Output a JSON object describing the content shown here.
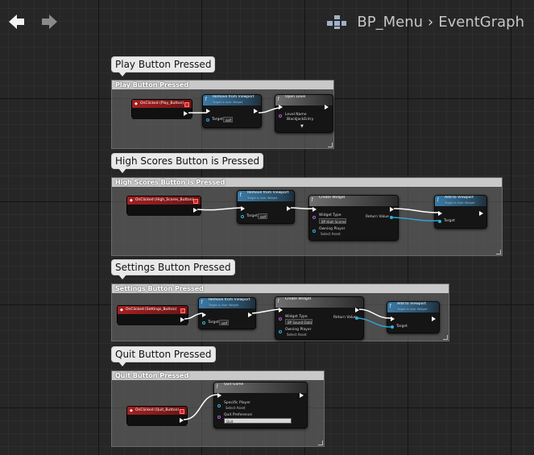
{
  "toolbar": {
    "back_icon": "arrow-left-icon",
    "forward_icon": "arrow-right-icon",
    "blueprint_icon": "blueprint-grid-icon",
    "breadcrumb_root": "BP_Menu",
    "breadcrumb_separator": "›",
    "breadcrumb_current": "EventGraph"
  },
  "groups": [
    {
      "bubble": "Play Button Pressed",
      "comment": "Play Button Pressed",
      "event": "OnClicked (Play_Button)",
      "node1": {
        "title": "Remove from Viewport",
        "sub": "Target is User Widget",
        "target": "Target",
        "self": "self"
      },
      "node2": {
        "title": "Open Level",
        "level_name": "Level Name",
        "level_value": "BlackJackEntry"
      }
    },
    {
      "bubble": "High Scores Button is Pressed",
      "comment": "High Scores Button is Pressed",
      "event": "OnClicked (High_Scores_Button)",
      "node1": {
        "title": "Remove from Viewport",
        "sub": "Target is User Widget",
        "target": "Target",
        "self": "self"
      },
      "node2": {
        "title": "Create Widget",
        "class": "Widget Type",
        "class_value": "BP High Scores",
        "owner": "Owning Player",
        "owner_value": "Select Asset",
        "ret": "Return Value"
      },
      "node3": {
        "title": "Add to Viewport",
        "sub": "Target is User Widget",
        "target": "Target"
      }
    },
    {
      "bubble": "Settings Button Pressed",
      "comment": "Settings Button Pressed",
      "event": "OnClicked (Settings_Button)",
      "node1": {
        "title": "Remove from Viewport",
        "sub": "Target is User Widget",
        "target": "Target",
        "self": "self"
      },
      "node2": {
        "title": "Create Widget",
        "class": "Widget Type",
        "class_value": "BP Sound Options",
        "owner": "Owning Player",
        "owner_value": "Select Asset",
        "ret": "Return Value"
      },
      "node3": {
        "title": "Add to Viewport",
        "sub": "Target is User Widget",
        "target": "Target"
      }
    },
    {
      "bubble": "Quit Button Pressed",
      "comment": "Quit Button Pressed",
      "event": "OnClicked (Quit_Button)",
      "node1": {
        "title": "Quit Game",
        "player": "Specific Player",
        "player_value": "Select Asset",
        "pref": "Quit Preference",
        "pref_value": "Quit"
      }
    }
  ],
  "colors": {
    "exec_wire": "#ffffff",
    "object_wire": "#2fa3d6",
    "event_header": "#a32020",
    "func_header": "#3b7aa6"
  }
}
